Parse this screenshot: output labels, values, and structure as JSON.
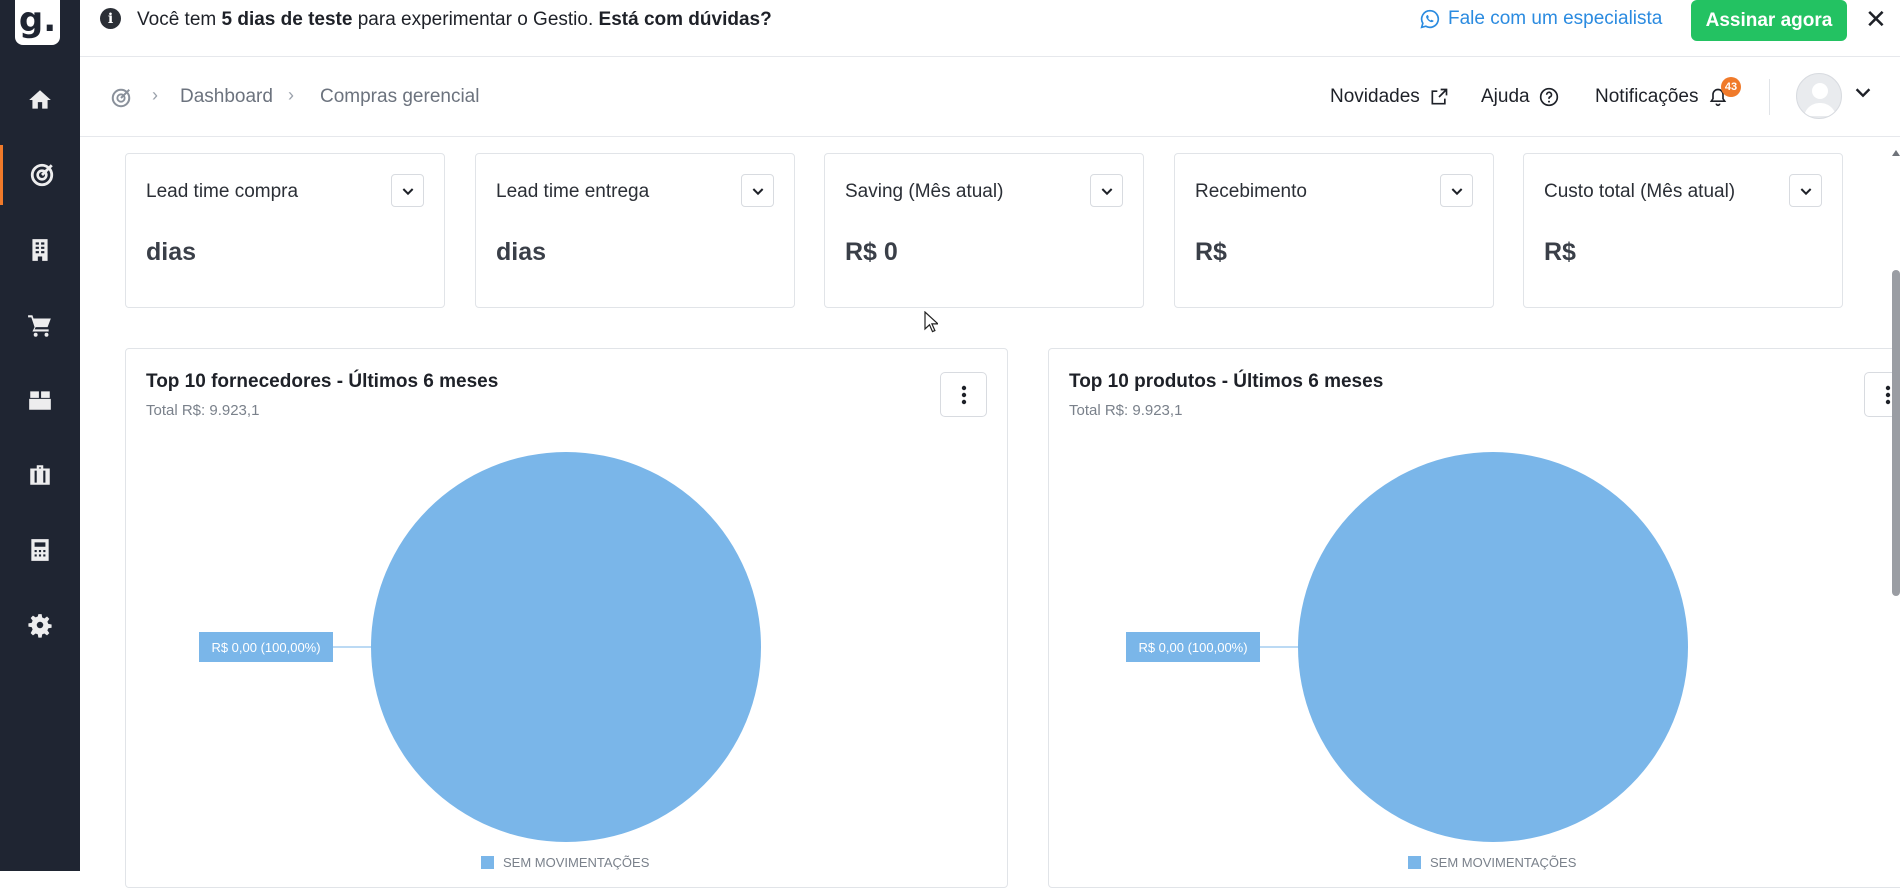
{
  "app": {
    "logo_letter": "g."
  },
  "sidebar": {
    "items": [
      {
        "name": "home-icon",
        "active": false
      },
      {
        "name": "dashboard-target-icon",
        "active": true
      },
      {
        "name": "building-icon",
        "active": false
      },
      {
        "name": "cart-icon",
        "active": false
      },
      {
        "name": "box-icon",
        "active": false
      },
      {
        "name": "briefcase-icon",
        "active": false
      },
      {
        "name": "calculator-icon",
        "active": false
      },
      {
        "name": "gear-icon",
        "active": false
      }
    ]
  },
  "banner": {
    "text_prefix": "Você tem ",
    "text_bold_days": "5 dias de teste",
    "text_middle": " para experimentar o Gestio. ",
    "text_bold_question": "Está com dúvidas?",
    "specialist_link": "Fale com um especialista",
    "subscribe_label": "Assinar agora",
    "close_glyph": "✕"
  },
  "breadcrumb": {
    "items": [
      "Dashboard",
      "Compras gerencial"
    ],
    "separator": "›"
  },
  "topnav": {
    "news_label": "Novidades",
    "help_label": "Ajuda",
    "notifications_label": "Notificações",
    "notifications_count": "43"
  },
  "kpis": [
    {
      "title": "Lead time compra",
      "value": "dias"
    },
    {
      "title": "Lead time entrega",
      "value": "dias"
    },
    {
      "title": "Saving (Mês atual)",
      "value": "R$ 0"
    },
    {
      "title": "Recebimento",
      "value": "R$"
    },
    {
      "title": "Custo total (Mês atual)",
      "value": "R$"
    }
  ],
  "colors": {
    "sidebar_bg": "#1f2532",
    "accent_orange": "#f07a2a",
    "subscribe_green": "#23c262",
    "link_blue": "#2b8be0",
    "pie_blue": "#7ab6e9"
  },
  "chart_data": [
    {
      "type": "pie",
      "title": "Top 10 fornecedores - Últimos 6 meses",
      "subtitle": "Total R$: 9.923,1",
      "slices": [
        {
          "label": "SEM MOVIMENTAÇÕES",
          "value": 100,
          "data_label": "R$ 0,00 (100,00%)"
        }
      ],
      "legend": [
        "SEM MOVIMENTAÇÕES"
      ],
      "legend_position": "bottom"
    },
    {
      "type": "pie",
      "title": "Top 10 produtos - Últimos 6 meses",
      "subtitle": "Total R$: 9.923,1",
      "slices": [
        {
          "label": "SEM MOVIMENTAÇÕES",
          "value": 100,
          "data_label": "R$ 0,00 (100,00%)"
        }
      ],
      "legend": [
        "SEM MOVIMENTAÇÕES"
      ],
      "legend_position": "bottom"
    }
  ]
}
